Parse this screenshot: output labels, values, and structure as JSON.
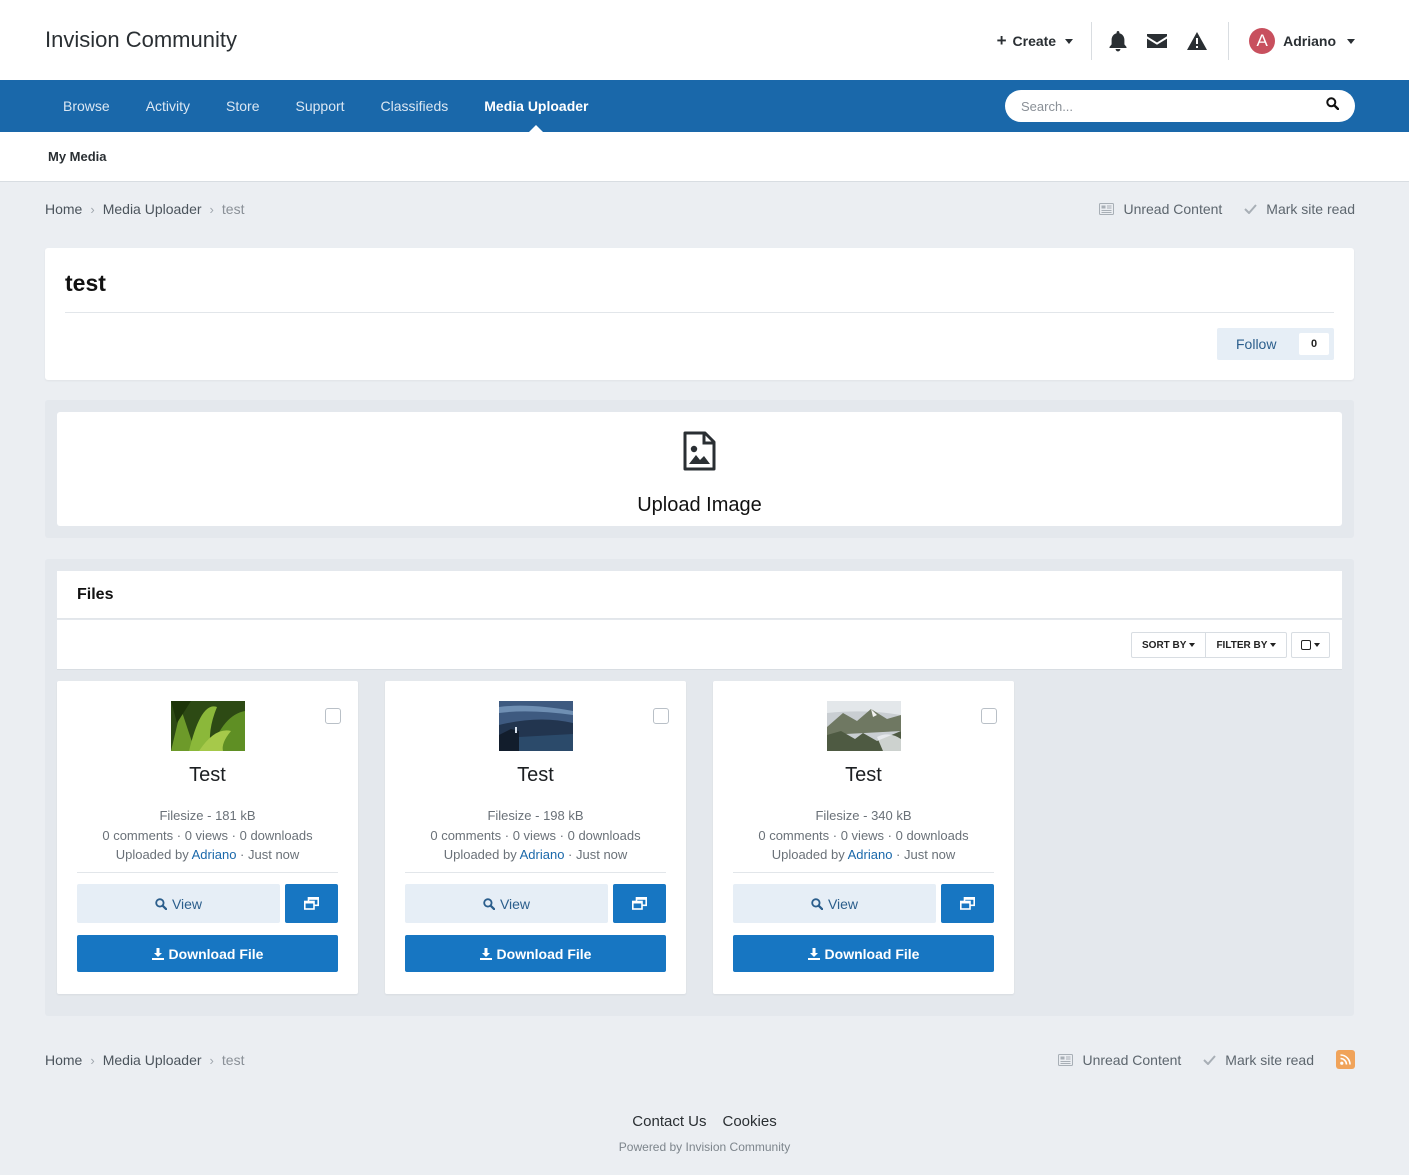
{
  "header": {
    "site_title": "Invision Community",
    "create_label": "Create",
    "user_name": "Adriano",
    "user_initial": "A",
    "icons": [
      "bell-icon",
      "envelope-icon",
      "warning-icon"
    ]
  },
  "nav": {
    "items": [
      "Browse",
      "Activity",
      "Store",
      "Support",
      "Classifieds",
      "Media Uploader"
    ],
    "active": "Media Uploader",
    "search_placeholder": "Search..."
  },
  "subnav": {
    "item": "My Media"
  },
  "breadcrumb": {
    "home": "Home",
    "section": "Media Uploader",
    "current": "test",
    "unread": "Unread Content",
    "mark_read": "Mark site read"
  },
  "page": {
    "title": "test",
    "follow_label": "Follow",
    "follow_count": "0"
  },
  "upload": {
    "label": "Upload Image"
  },
  "files": {
    "title": "Files",
    "sort_label": "SORT BY",
    "filter_label": "FILTER BY",
    "items": [
      {
        "title": "Test",
        "filesize": "Filesize - 181 kB",
        "stats": "0 comments · 0 views · 0 downloads",
        "uploaded_prefix": "Uploaded by",
        "uploader": "Adriano",
        "time": "· Just now",
        "view_label": "View",
        "download_label": "Download File"
      },
      {
        "title": "Test",
        "filesize": "Filesize - 198 kB",
        "stats": "0 comments · 0 views · 0 downloads",
        "uploaded_prefix": "Uploaded by",
        "uploader": "Adriano",
        "time": "· Just now",
        "view_label": "View",
        "download_label": "Download File"
      },
      {
        "title": "Test",
        "filesize": "Filesize - 340 kB",
        "stats": "0 comments · 0 views · 0 downloads",
        "uploaded_prefix": "Uploaded by",
        "uploader": "Adriano",
        "time": "· Just now",
        "view_label": "View",
        "download_label": "Download File"
      }
    ]
  },
  "footer": {
    "contact": "Contact Us",
    "cookies": "Cookies",
    "powered": "Powered by Invision Community"
  },
  "colors": {
    "brand": "#1a68aa",
    "button": "#1776c2",
    "background": "#ebeef2"
  }
}
